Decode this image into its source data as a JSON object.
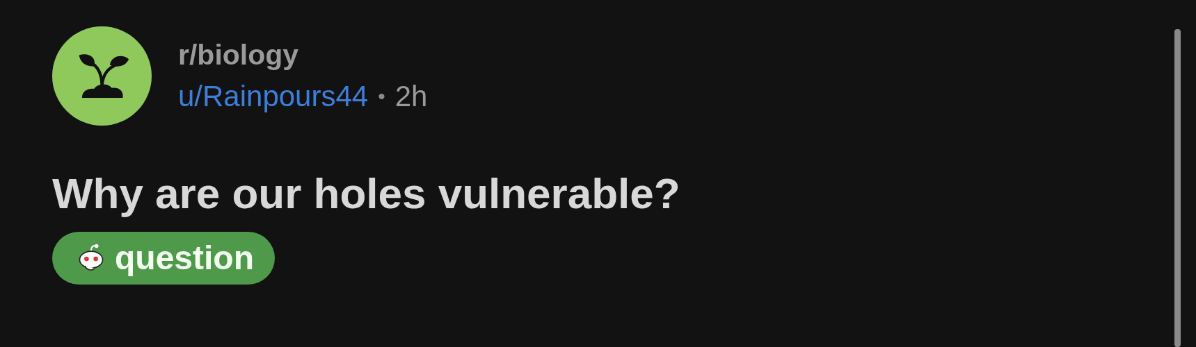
{
  "post": {
    "subreddit": "r/biology",
    "author": "u/Rainpours44",
    "separator": "•",
    "age": "2h",
    "title": "Why are our holes vulnerable?",
    "flair": {
      "label": "question",
      "color": "#4f9a4a"
    }
  }
}
